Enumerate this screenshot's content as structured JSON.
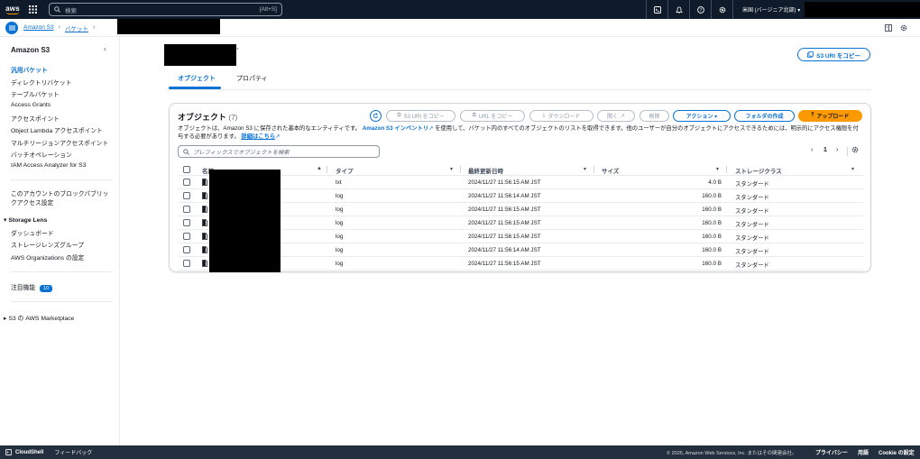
{
  "topnav": {
    "logo_text": "aws",
    "search_placeholder": "検索",
    "search_shortcut": "[Alt+S]",
    "region": "米国 (バージニア北部) ▾",
    "icons": [
      "cloudshell-icon",
      "bell-icon",
      "help-icon",
      "gear-icon"
    ]
  },
  "breadcrumb": {
    "items": [
      "Amazon S3",
      "バケット"
    ]
  },
  "sidebar": {
    "title": "Amazon S3",
    "group1": [
      "汎用バケット",
      "ディレクトリバケット",
      "テーブルバケット",
      "Access Grants",
      "アクセスポイント",
      "Object Lambda アクセスポイント",
      "マルチリージョンアクセスポイント",
      "バッチオペレーション",
      "IAM Access Analyzer for S3"
    ],
    "block_public": "このアカウントのブロックパブリックアクセス設定",
    "storage_lens": {
      "heading": "Storage Lens",
      "items": [
        "ダッシュボード",
        "ストレージレンズグループ",
        "AWS Organizations の設定"
      ]
    },
    "featured": "注目機能",
    "featured_count": "10",
    "marketplace": "S3 の AWS Marketplace"
  },
  "main": {
    "title_suffix": "'",
    "copy_s3_uri": "S3 URI をコピー",
    "tabs": [
      "オブジェクト",
      "プロパティ"
    ]
  },
  "objects_panel": {
    "title": "オブジェクト",
    "count": "(7)",
    "buttons": {
      "copy_s3_uri": "S3 URI をコピー",
      "copy_url": "URL をコピー",
      "download": "ダウンロード",
      "open": "開く",
      "delete": "削除",
      "actions": "アクション ▾",
      "create_folder": "フォルダの作成",
      "upload": "アップロード"
    },
    "description": {
      "part1": "オブジェクトは、Amazon S3 に保存された基本的なエンティティです。",
      "link1": "Amazon S3 インベントリ",
      "part2": "を使用して、バケット内のすべてのオブジェクトのリストを取得できます。他のユーザーが自分のオブジェクトにアクセスできるためには、明示的にアクセス権限を付与する必要があります。",
      "link2": "詳細はこちら"
    },
    "filter_placeholder": "プレフィックスでオブジェクトを検索",
    "page": "1",
    "columns": [
      "名前",
      "タイプ",
      "最終更新日時",
      "サイズ",
      "ストレージクラス"
    ],
    "rows": [
      {
        "type": "txt",
        "modified": "2024/11/27 11:56:15 AM JST",
        "size": "4.0 B",
        "class": "スタンダード"
      },
      {
        "type": "log",
        "modified": "2024/11/27 11:56:14 AM JST",
        "size": "160.0 B",
        "class": "スタンダード"
      },
      {
        "type": "log",
        "modified": "2024/11/27 11:56:15 AM JST",
        "size": "160.0 B",
        "class": "スタンダード"
      },
      {
        "type": "log",
        "modified": "2024/11/27 11:56:15 AM JST",
        "size": "160.0 B",
        "class": "スタンダード"
      },
      {
        "type": "log",
        "modified": "2024/11/27 11:56:15 AM JST",
        "size": "160.0 B",
        "class": "スタンダード"
      },
      {
        "type": "log",
        "modified": "2024/11/27 11:56:14 AM JST",
        "size": "160.0 B",
        "class": "スタンダード"
      },
      {
        "type": "log",
        "modified": "2024/11/27 11:56:15 AM JST",
        "size": "160.0 B",
        "class": "スタンダード"
      }
    ]
  },
  "footer": {
    "cloudshell": "CloudShell",
    "feedback": "フィードバック",
    "copyright": "© 2025, Amazon Web Services, Inc. またはその関連会社。",
    "privacy": "プライバシー",
    "terms": "用語",
    "cookie": "Cookie の設定"
  },
  "colors": {
    "nav_bg": "#0f1b2a",
    "link": "#0972d3",
    "upload": "#ff9900",
    "footer_bg": "#232f3e"
  }
}
